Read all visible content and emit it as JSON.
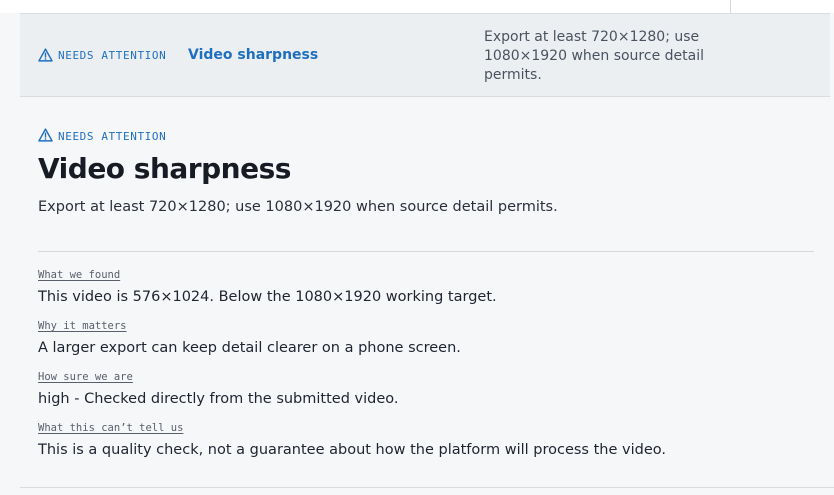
{
  "summary_row": {
    "status_label": "NEEDS ATTENTION",
    "title": "Video sharpness",
    "description": "Export at least 720×1280; use 1080×1920 when source detail permits."
  },
  "detail": {
    "status_label": "NEEDS ATTENTION",
    "title": "Video sharpness",
    "description": "Export at least 720×1280; use 1080×1920 when source detail permits.",
    "facts": [
      {
        "label": "What we found",
        "value": "This video is 576×1024. Below the 1080×1920 working target."
      },
      {
        "label": "Why it matters",
        "value": "A larger export can keep detail clearer on a phone screen."
      },
      {
        "label": "How sure we are",
        "value": "high - Checked directly from the submitted video."
      },
      {
        "label": "What this can’t tell us",
        "value": "This is a quality check, not a guarantee about how the platform will process the video."
      }
    ]
  },
  "colors": {
    "accent": "#1f6fc0",
    "row_background": "#eceff2",
    "page_background": "#f6f7f9"
  },
  "icons": {
    "status": "warning-triangle-icon"
  }
}
